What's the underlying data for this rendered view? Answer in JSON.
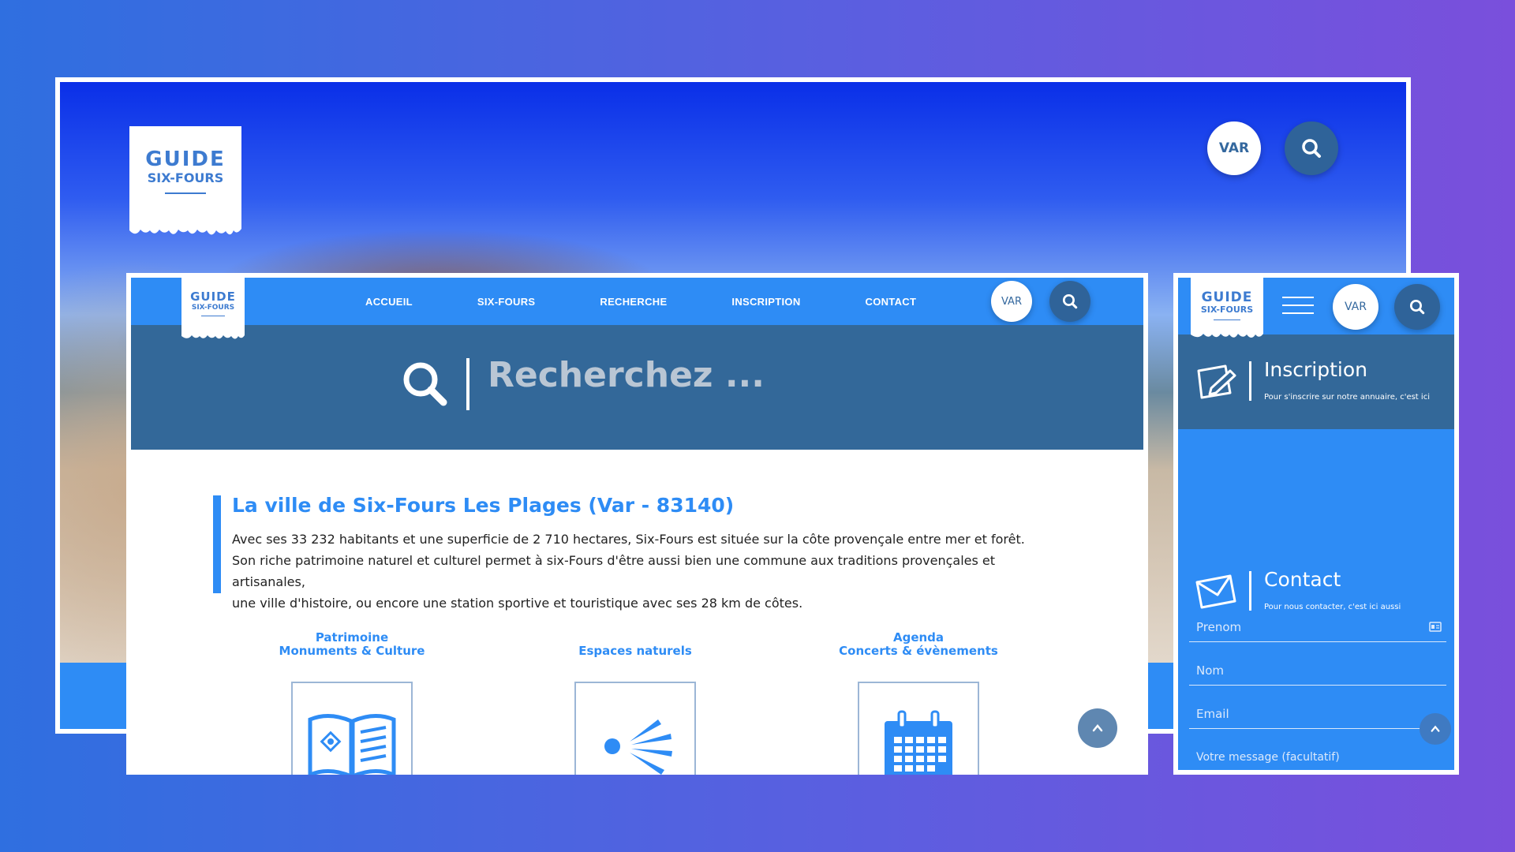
{
  "brand": {
    "logo_line1": "GUIDE",
    "logo_line2": "SIX-FOURS",
    "primary_color": "#2e8cf5",
    "dark_color": "#336899"
  },
  "hero": {
    "var_button": "VAR",
    "search_icon": "search-icon"
  },
  "nav": {
    "items": [
      "ACCUEIL",
      "SIX-FOURS",
      "RECHERCHE",
      "INSCRIPTION",
      "CONTACT"
    ],
    "var_button": "VAR"
  },
  "search": {
    "placeholder": "Recherchez ..."
  },
  "intro": {
    "title": "La ville de Six-Fours Les Plages (Var - 83140)",
    "line1": "Avec ses 33 232 habitants et une superficie de 2 710 hectares, Six-Fours est située sur la côte provençale entre mer et forêt.",
    "line2": "Son riche patrimoine naturel et culturel permet à six-Fours d'être aussi bien une commune aux traditions provençales et artisanales,",
    "line3": "une ville d'histoire, ou encore une station sportive et touristique avec ses 28 km de côtes."
  },
  "categories": [
    {
      "line1": "Patrimoine",
      "line2": "Monuments & Culture",
      "icon": "book-icon"
    },
    {
      "line1": "",
      "line2": "Espaces naturels",
      "icon": "sun-icon"
    },
    {
      "line1": "Agenda",
      "line2": "Concerts & évènements",
      "icon": "calendar-icon"
    }
  ],
  "mobile": {
    "var_button": "VAR",
    "inscription": {
      "title": "Inscription",
      "subtitle": "Pour s'inscrire sur notre annuaire, c'est ici",
      "icon": "edit-icon"
    },
    "contact": {
      "title": "Contact",
      "subtitle": "Pour nous contacter, c'est ici aussi",
      "icon": "envelope-icon"
    },
    "form": {
      "prenom": "Prenom",
      "nom": "Nom",
      "email": "Email",
      "message": "Votre message (facultatif)"
    }
  }
}
